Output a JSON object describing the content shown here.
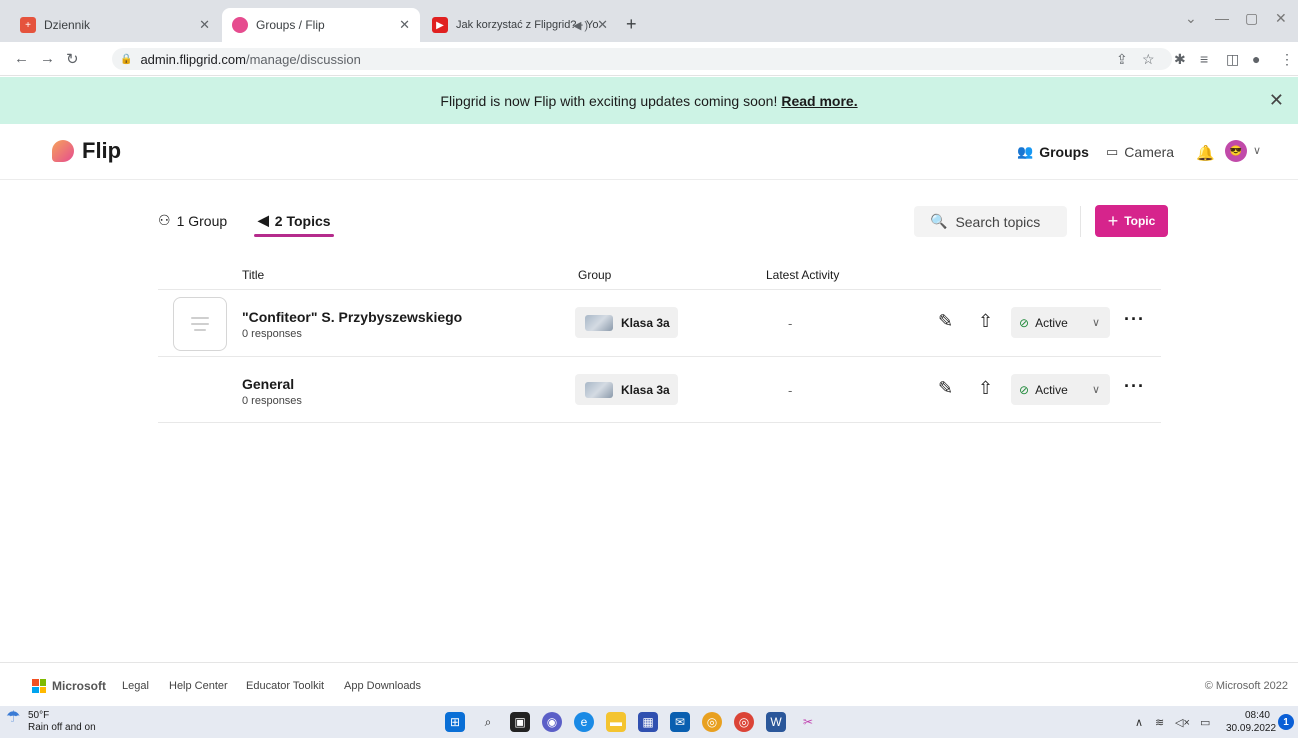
{
  "browser": {
    "tabs": [
      {
        "title": "Dziennik",
        "fav_color": "#e5533d"
      },
      {
        "title": "Groups / Flip",
        "fav_color": "#e64c8f"
      },
      {
        "title": "Jak korzystać z Flipgrid? - Yo",
        "fav_color": "#e02020"
      }
    ],
    "url_host": "admin.flipgrid.com",
    "url_path": "/manage/discussion"
  },
  "banner": {
    "message": "Flipgrid is now Flip with exciting updates coming soon!",
    "link": "Read more."
  },
  "app": {
    "logo": "Flip",
    "nav_groups": "Groups",
    "nav_camera": "Camera"
  },
  "subnav": {
    "groups_label": "1 Group",
    "topics_label": "2 Topics",
    "search_placeholder": "Search topics",
    "add_topic_label": "Topic"
  },
  "table": {
    "headers": [
      "Title",
      "Group",
      "Latest Activity"
    ],
    "rows": [
      {
        "title": "\"Confiteor\" S. Przybyszewskiego",
        "responses": "0 responses",
        "group": "Klasa 3a",
        "latest": "-",
        "status": "Active"
      },
      {
        "title": "General",
        "responses": "0 responses",
        "group": "Klasa 3a",
        "latest": "-",
        "status": "Active"
      }
    ]
  },
  "footer": {
    "brand": "Microsoft",
    "links": [
      "Legal",
      "Help Center",
      "Educator Toolkit",
      "App Downloads"
    ],
    "copyright": "© Microsoft 2022"
  },
  "taskbar": {
    "weather_temp": "50°F",
    "weather_desc": "Rain off and on",
    "time": "08:40",
    "date": "30.09.2022",
    "notifications": "1"
  },
  "colors": {
    "accent": "#d6248c",
    "banner_bg": "#cdf3e5",
    "active_check": "#1f8a3a"
  }
}
